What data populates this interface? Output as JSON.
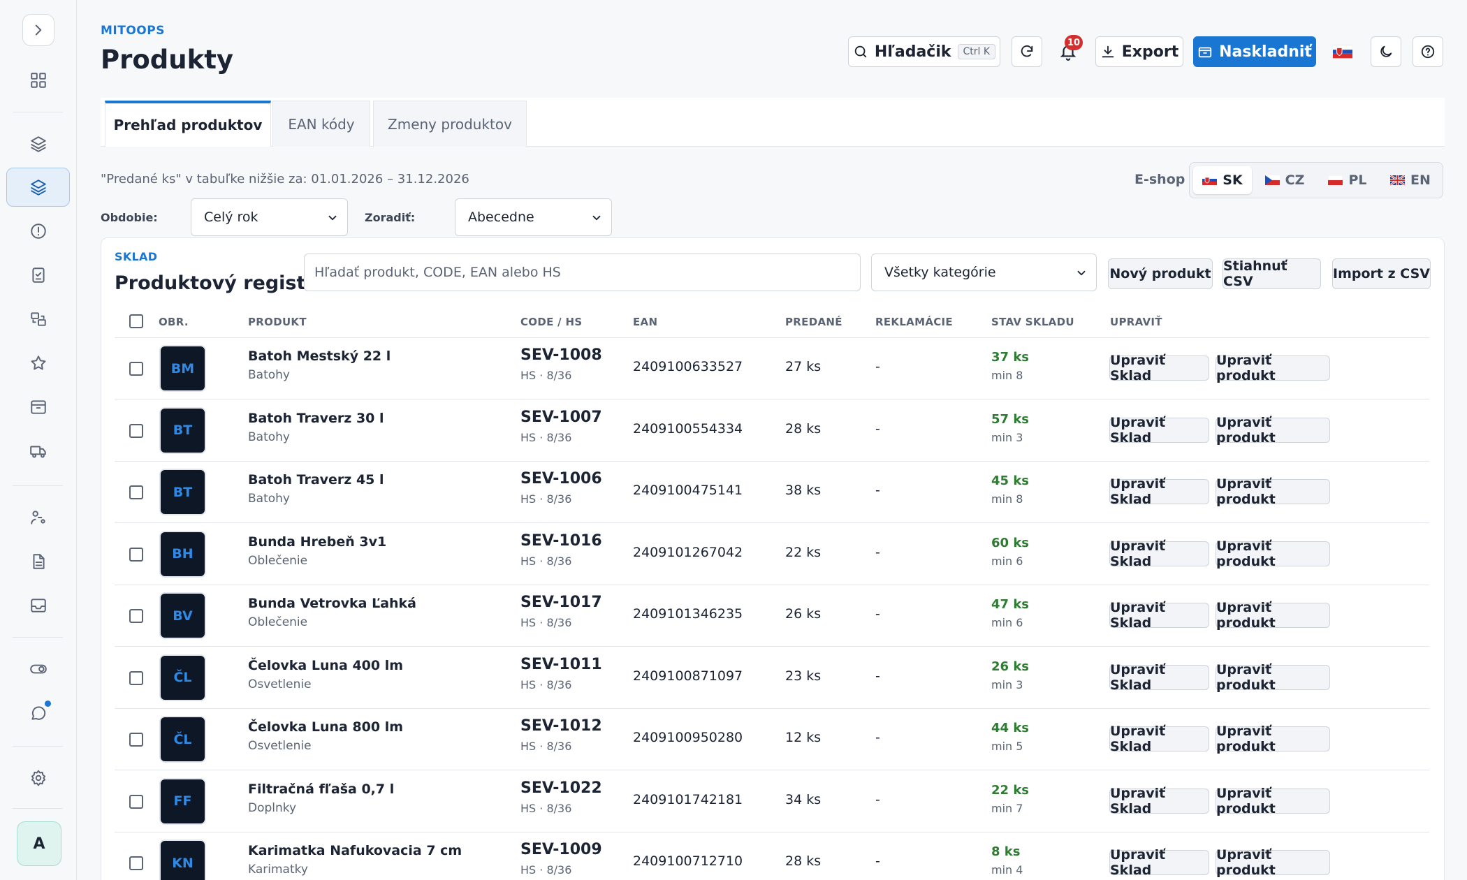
{
  "app": {
    "brand": "MITOOPS",
    "page_title": "Produkty"
  },
  "toolbar": {
    "search_label": "Hľadačik",
    "search_shortcut": "Ctrl K",
    "notifications_count": "10",
    "export_label": "Export",
    "stock_in_label": "Naskladniť",
    "language_flag": "sk-flag-icon"
  },
  "tabs": [
    {
      "label": "Prehľad produktov",
      "active": true
    },
    {
      "label": "EAN kódy",
      "active": false
    },
    {
      "label": "Zmeny produktov",
      "active": false
    }
  ],
  "filters": {
    "note": "\"Predané ks\" v tabuľke nižšie za: 01.01.2026 – 31.12.2026",
    "period_label": "Obdobie:",
    "period_value": "Celý rok",
    "sort_label": "Zoradiť:",
    "sort_value": "Abecedne",
    "eshop_label": "E-shop",
    "eshop_langs": [
      {
        "code": "SK",
        "active": true
      },
      {
        "code": "CZ",
        "active": false
      },
      {
        "code": "PL",
        "active": false
      },
      {
        "code": "EN",
        "active": false
      }
    ]
  },
  "register": {
    "section": "SKLAD",
    "title": "Produktový register",
    "search_placeholder": "Hľadať produkt, CODE, EAN alebo HS",
    "category_value": "Všetky kategórie",
    "new_product": "Nový produkt",
    "download_csv": "Stiahnuť CSV",
    "import_csv": "Import z CSV"
  },
  "table": {
    "headers": {
      "img": "OBR.",
      "product": "PRODUKT",
      "code": "CODE / HS",
      "ean": "EAN",
      "sold": "PREDANÉ",
      "claims": "REKLAMÁCIE",
      "stock": "STAV SKLADU",
      "edit": "UPRAVIŤ"
    },
    "edit_stock_label": "Upraviť Sklad",
    "edit_product_label": "Upraviť produkt",
    "rows": [
      {
        "initials": "BM",
        "name": "Batoh Mestský 22 l",
        "category": "Batohy",
        "code": "SEV-1008",
        "hs": "HS · 8/36",
        "ean": "2409100633527",
        "sold": "27 ks",
        "claims": "-",
        "stock": "37 ks",
        "min": "min 8"
      },
      {
        "initials": "BT",
        "name": "Batoh Traverz 30 l",
        "category": "Batohy",
        "code": "SEV-1007",
        "hs": "HS · 8/36",
        "ean": "2409100554334",
        "sold": "28 ks",
        "claims": "-",
        "stock": "57 ks",
        "min": "min 3"
      },
      {
        "initials": "BT",
        "name": "Batoh Traverz 45 l",
        "category": "Batohy",
        "code": "SEV-1006",
        "hs": "HS · 8/36",
        "ean": "2409100475141",
        "sold": "38 ks",
        "claims": "-",
        "stock": "45 ks",
        "min": "min 8"
      },
      {
        "initials": "BH",
        "name": "Bunda Hrebeň 3v1",
        "category": "Oblečenie",
        "code": "SEV-1016",
        "hs": "HS · 8/36",
        "ean": "2409101267042",
        "sold": "22 ks",
        "claims": "-",
        "stock": "60 ks",
        "min": "min 6"
      },
      {
        "initials": "BV",
        "name": "Bunda Vetrovka Ľahká",
        "category": "Oblečenie",
        "code": "SEV-1017",
        "hs": "HS · 8/36",
        "ean": "2409101346235",
        "sold": "26 ks",
        "claims": "-",
        "stock": "47 ks",
        "min": "min 6"
      },
      {
        "initials": "ČL",
        "name": "Čelovka Luna 400 lm",
        "category": "Osvetlenie",
        "code": "SEV-1011",
        "hs": "HS · 8/36",
        "ean": "2409100871097",
        "sold": "23 ks",
        "claims": "-",
        "stock": "26 ks",
        "min": "min 3"
      },
      {
        "initials": "ČL",
        "name": "Čelovka Luna 800 lm",
        "category": "Osvetlenie",
        "code": "SEV-1012",
        "hs": "HS · 8/36",
        "ean": "2409100950280",
        "sold": "12 ks",
        "claims": "-",
        "stock": "44 ks",
        "min": "min 5"
      },
      {
        "initials": "FF",
        "name": "Filtračná fľaša 0,7 l",
        "category": "Doplnky",
        "code": "SEV-1022",
        "hs": "HS · 8/36",
        "ean": "2409101742181",
        "sold": "34 ks",
        "claims": "-",
        "stock": "22 ks",
        "min": "min 7"
      },
      {
        "initials": "KN",
        "name": "Karimatka Nafukovacia 7 cm",
        "category": "Karimatky",
        "code": "SEV-1009",
        "hs": "HS · 8/36",
        "ean": "2409100712710",
        "sold": "28 ks",
        "claims": "-",
        "stock": "8 ks",
        "min": "min 4"
      }
    ]
  }
}
